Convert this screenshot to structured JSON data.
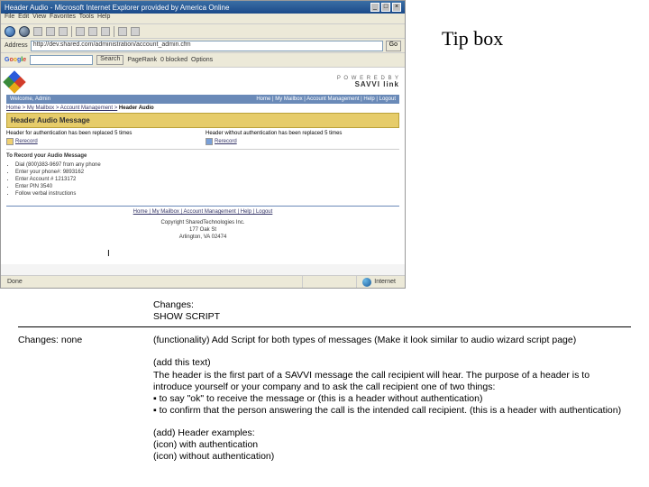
{
  "tipbox": {
    "label": "Tip box"
  },
  "browser": {
    "title_text": "Header Audio - Microsoft Internet Explorer provided by America Online",
    "address_url": "http://dev.shared.com/administration/account_admin.cfm",
    "go_label": "Go",
    "google_search_label": "Search",
    "pagerank": "PageRank",
    "blocked": "0 blocked",
    "options": "Options",
    "status_done": "Done",
    "status_zone": "Internet"
  },
  "page": {
    "powered_top": "P O W E R E D  B Y",
    "powered_brand": "SAVVI link",
    "welcome": "Welcome, Admin",
    "top_nav": "Home | My Mailbox | Account Management | Help | Logout",
    "breadcrumb_links": "Home > My Mailbox > Account Management >",
    "breadcrumb_current": "Header Audio",
    "banner": "Header Audio Message",
    "col1_text": "Header for authentication has been replaced 5 times",
    "col1_link": "Rerecord",
    "col2_text": "Header without authentication has been replaced 5 times",
    "col2_link": "Rerecord",
    "instr_head": "To Record your Audio Message",
    "steps": [
      "Dial (800)383-9697 from any phone",
      "Enter your phone#: 9893162",
      "Enter Account # 1213172",
      "Enter PIN 3540",
      "Follow verbal instructions"
    ],
    "foot_links": "Home | My Mailbox | Account Management | Help | Logout",
    "addr_line1": "Copyright SharedTechnologies Inc.",
    "addr_line2": "177 Oak St",
    "addr_line3": "Arlington, VA 02474"
  },
  "annotations": {
    "changes_top_label": "Changes:",
    "changes_top_value": "SHOW SCRIPT",
    "changes_left": "Changes:  none",
    "func_text": "(functionality) Add Script for both types of messages (Make it look similar to audio wizard script page)",
    "addtext_lead": "(add this text)",
    "addtext_body": "The header is the first part of a SAVVI message the call recipient will hear.  The purpose of a header is to introduce yourself or your company and to ask the call recipient one of two things:",
    "bullets": [
      "to say \"ok\" to receive the message or (this is a header without authentication)",
      "to confirm that the person answering the call is the intended call recipient. (this is a header with authentication)"
    ],
    "examples_head": "(add) Header examples:",
    "ex1": "(icon) with authentication",
    "ex2": "(icon) without authentication)"
  }
}
